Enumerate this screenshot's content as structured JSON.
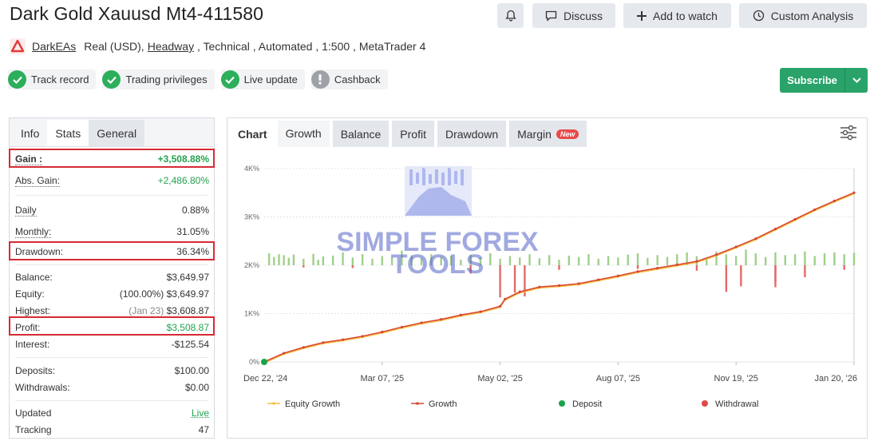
{
  "header": {
    "title": "Dark Gold Xauusd Mt4-411580",
    "buttons": {
      "discuss": "Discuss",
      "watch": "Add to watch",
      "analysis": "Custom Analysis"
    }
  },
  "meta": {
    "owner": "DarkEAs",
    "account_type": "Real (USD), ",
    "broker": "Headway",
    "details": " , Technical , Automated , 1:500 , MetaTrader 4"
  },
  "badges": [
    {
      "label": "Track record",
      "status": "verified"
    },
    {
      "label": "Trading privileges",
      "status": "verified"
    },
    {
      "label": "Live update",
      "status": "verified"
    },
    {
      "label": "Cashback",
      "status": "unavailable"
    }
  ],
  "subscribe_label": "Subscribe",
  "left_tabs": [
    "Info",
    "Stats",
    "General"
  ],
  "stats": {
    "gain": {
      "label": "Gain :",
      "value": "+3,508.88%"
    },
    "abs_gain": {
      "label": "Abs. Gain:",
      "value": "+2,486.80%"
    },
    "daily": {
      "label": "Daily",
      "value": "0.88%"
    },
    "monthly": {
      "label": "Monthly:",
      "value": "31.05%"
    },
    "drawdown": {
      "label": "Drawdown:",
      "value": "36.34%"
    },
    "balance": {
      "label": "Balance:",
      "value": "$3,649.97"
    },
    "equity": {
      "label": "Equity:",
      "note": "(100.00%)",
      "value": "$3,649.97"
    },
    "highest": {
      "label": "Highest:",
      "note": "(Jan 23)",
      "value": "$3,608.87"
    },
    "profit": {
      "label": "Profit:",
      "value": "$3,508.87"
    },
    "interest": {
      "label": "Interest:",
      "value": "-$125.54"
    },
    "deposits": {
      "label": "Deposits:",
      "value": "$100.00"
    },
    "withdrawals": {
      "label": "Withdrawals:",
      "value": "$0.00"
    },
    "updated": {
      "label": "Updated",
      "value": "Live"
    },
    "tracking": {
      "label": "Tracking",
      "value": "47"
    }
  },
  "chart_tabs": {
    "chart": "Chart",
    "growth": "Growth",
    "balance": "Balance",
    "profit": "Profit",
    "drawdown": "Drawdown",
    "margin": "Margin",
    "new_badge": "New"
  },
  "watermark": {
    "line1": "SIMPLE FOREX",
    "line2": "TOOLS"
  },
  "colors": {
    "growth_line": "#d9472f",
    "equity_line": "#f3c13a",
    "deposit": "#1aa34a",
    "withdrawal": "#e04848",
    "bar_pos": "#9fd08a",
    "bar_neg": "#e36a6a",
    "accent": "#29a36a",
    "highlight": "#d62b35"
  },
  "chart_data": {
    "type": "line",
    "y_tick_labels": [
      "0%",
      "1K%",
      "2K%",
      "3K%",
      "4K%"
    ],
    "x_tick_labels": [
      "Dec 22, '24",
      "Mar 07, '25",
      "May 02, '25",
      "Aug 07, '25",
      "Nov 19, '25",
      "Jan 20, '26"
    ],
    "ylim": [
      0,
      4000
    ],
    "x_index_range": [
      0,
      120
    ],
    "tick_index": [
      0,
      24,
      48,
      72,
      96,
      120
    ],
    "legend": [
      "Equity Growth",
      "Growth",
      "Deposit",
      "Withdrawal"
    ],
    "series": [
      {
        "name": "Growth",
        "x": [
          0,
          4,
          8,
          12,
          16,
          20,
          24,
          28,
          32,
          36,
          40,
          44,
          48,
          49,
          52,
          56,
          60,
          64,
          68,
          72,
          76,
          80,
          84,
          88,
          92,
          96,
          100,
          104,
          108,
          112,
          116,
          120
        ],
        "y": [
          0,
          180,
          300,
          400,
          460,
          530,
          620,
          720,
          810,
          880,
          970,
          1040,
          1150,
          1300,
          1450,
          1550,
          1580,
          1620,
          1700,
          1780,
          1870,
          1940,
          2010,
          2080,
          2220,
          2380,
          2550,
          2750,
          2950,
          3150,
          3330,
          3500
        ]
      }
    ],
    "daily_gain_bars": [
      {
        "x": 1,
        "y": 650
      },
      {
        "x": 2,
        "y": 450
      },
      {
        "x": 3,
        "y": 600
      },
      {
        "x": 4,
        "y": 550
      },
      {
        "x": 5,
        "y": 400
      },
      {
        "x": 6,
        "y": 580
      },
      {
        "x": 8,
        "y": 350
      },
      {
        "x": 10,
        "y": 620
      },
      {
        "x": 11,
        "y": 300
      },
      {
        "x": 12,
        "y": 480
      },
      {
        "x": 14,
        "y": 520
      },
      {
        "x": 16,
        "y": 700
      },
      {
        "x": 18,
        "y": 420
      },
      {
        "x": 20,
        "y": 600
      },
      {
        "x": 22,
        "y": 350
      },
      {
        "x": 24,
        "y": 500
      },
      {
        "x": 26,
        "y": 450
      },
      {
        "x": 28,
        "y": 800
      },
      {
        "x": 30,
        "y": 550
      },
      {
        "x": 32,
        "y": 380
      },
      {
        "x": 34,
        "y": 600
      },
      {
        "x": 36,
        "y": 450
      },
      {
        "x": 38,
        "y": 520
      },
      {
        "x": 40,
        "y": 300
      },
      {
        "x": 42,
        "y": 580
      },
      {
        "x": 44,
        "y": 400
      },
      {
        "x": 46,
        "y": 650
      },
      {
        "x": 48,
        "y": 350
      },
      {
        "x": 50,
        "y": 500
      },
      {
        "x": 52,
        "y": 420
      },
      {
        "x": 54,
        "y": 600
      },
      {
        "x": 56,
        "y": 380
      },
      {
        "x": 58,
        "y": 550
      },
      {
        "x": 60,
        "y": 300
      },
      {
        "x": 62,
        "y": 520
      },
      {
        "x": 64,
        "y": 450
      },
      {
        "x": 66,
        "y": 600
      },
      {
        "x": 68,
        "y": 350
      },
      {
        "x": 70,
        "y": 500
      },
      {
        "x": 72,
        "y": 420
      },
      {
        "x": 74,
        "y": 580
      },
      {
        "x": 76,
        "y": 650
      },
      {
        "x": 78,
        "y": 400
      },
      {
        "x": 80,
        "y": 550
      },
      {
        "x": 82,
        "y": 450
      },
      {
        "x": 84,
        "y": 600
      },
      {
        "x": 86,
        "y": 700
      },
      {
        "x": 88,
        "y": 500
      },
      {
        "x": 90,
        "y": 400
      },
      {
        "x": 92,
        "y": 750
      },
      {
        "x": 94,
        "y": 600
      },
      {
        "x": 96,
        "y": 500
      },
      {
        "x": 98,
        "y": 850
      },
      {
        "x": 100,
        "y": 650
      },
      {
        "x": 102,
        "y": 450
      },
      {
        "x": 104,
        "y": 700
      },
      {
        "x": 106,
        "y": 550
      },
      {
        "x": 108,
        "y": 600
      },
      {
        "x": 110,
        "y": 750
      },
      {
        "x": 112,
        "y": 500
      },
      {
        "x": 114,
        "y": 650
      },
      {
        "x": 116,
        "y": 700
      },
      {
        "x": 118,
        "y": 600
      },
      {
        "x": 120,
        "y": 680
      },
      {
        "x": 8,
        "y": -120
      },
      {
        "x": 18,
        "y": -150
      },
      {
        "x": 42,
        "y": -450
      },
      {
        "x": 48,
        "y": -1750
      },
      {
        "x": 51,
        "y": -1500
      },
      {
        "x": 53,
        "y": -1700
      },
      {
        "x": 60,
        "y": -250
      },
      {
        "x": 76,
        "y": -200
      },
      {
        "x": 88,
        "y": -300
      },
      {
        "x": 94,
        "y": -1450
      },
      {
        "x": 97,
        "y": -1150
      },
      {
        "x": 104,
        "y": -1200
      },
      {
        "x": 110,
        "y": -650
      },
      {
        "x": 118,
        "y": -250
      },
      {
        "x": 104,
        "y": -900
      }
    ],
    "deposits": [
      {
        "x": 0,
        "y": 0
      }
    ]
  }
}
